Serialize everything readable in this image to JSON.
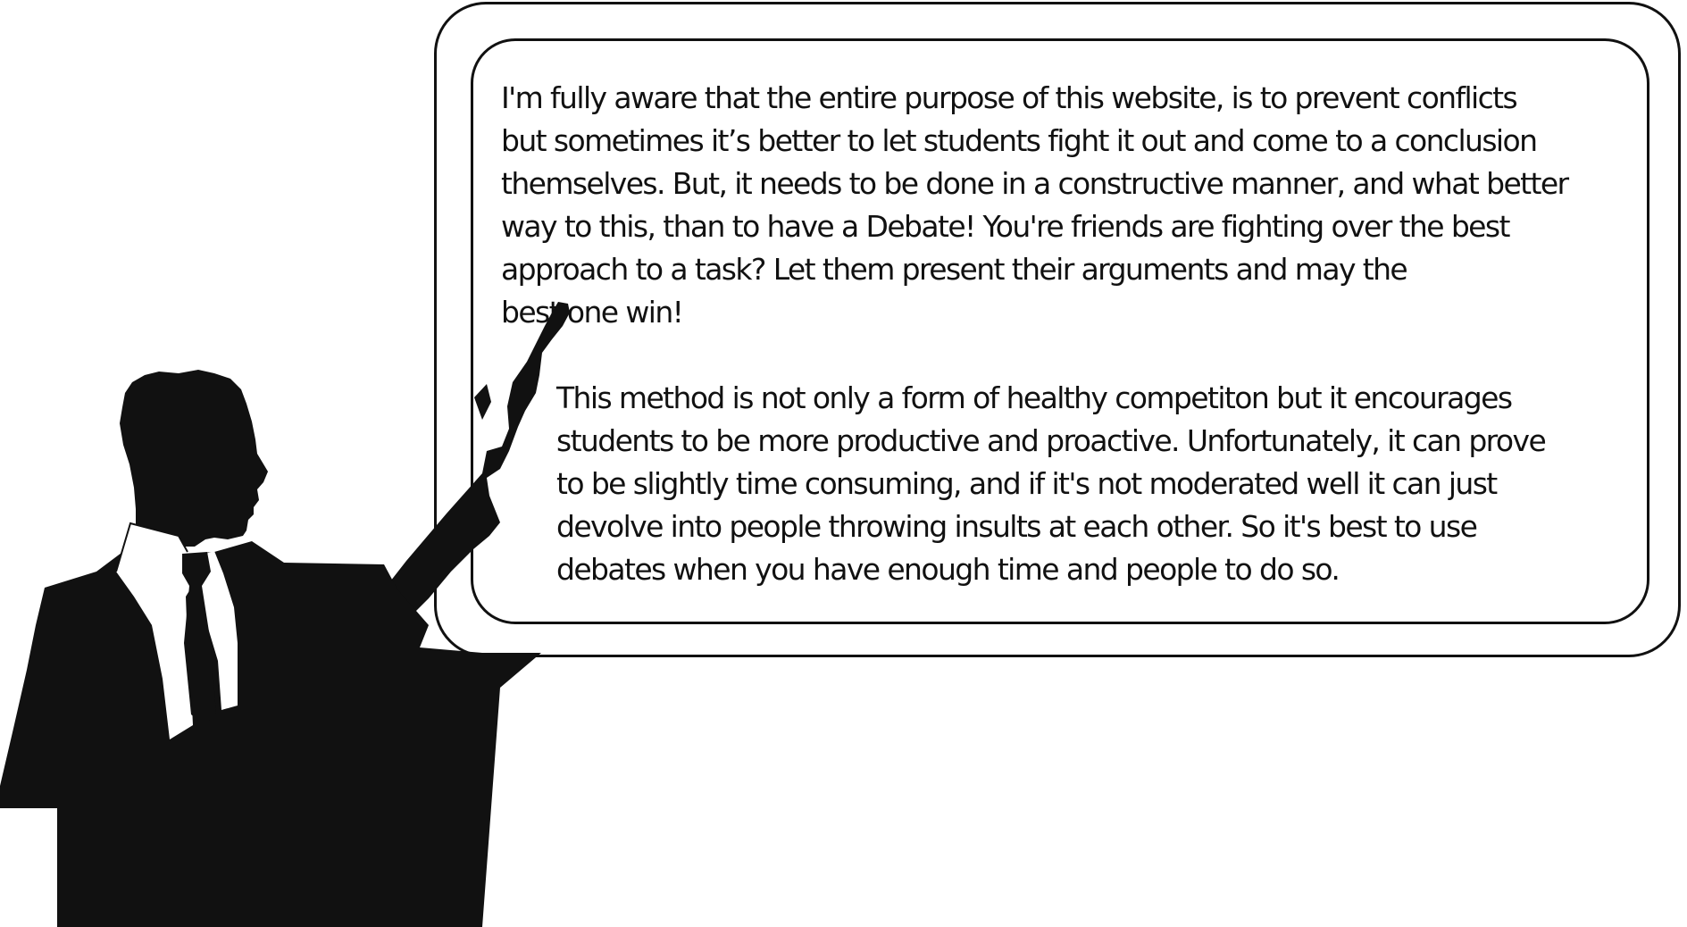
{
  "board": {
    "paragraph_1": [
      "I'm fully aware that the entire purpose of this website, is to prevent conflicts",
      "but sometimes it’s better to let students fight it out and come to a conclusion",
      "themselves. But, it needs to be done in a constructive manner, and what better",
      "way to this, than to have a Debate! You're friends are fighting over the best",
      "approach to a task? Let them  present their arguments and may the",
      "best one win!"
    ],
    "paragraph_2": [
      "This method is not only a form of healthy competiton but it encourages",
      "students to be more productive and proactive. Unfortunately, it can prove",
      "to be slightly time consuming, and if it's not moderated well it can just",
      "devolve into people throwing insults at each  other. So it's best to use",
      "debates when you have enough time and people  to do so."
    ]
  },
  "illustration": {
    "subject": "speaker-silhouette-at-podium",
    "colors": {
      "silhouette": "#111111",
      "shirt": "#ffffff",
      "board_border": "#111111",
      "background": "#ffffff"
    }
  }
}
